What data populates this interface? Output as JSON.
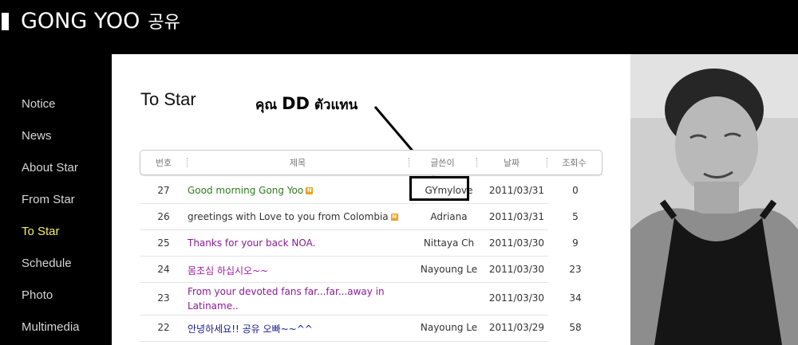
{
  "header": {
    "logo_text": "GONG YOO",
    "logo_korean": "공유"
  },
  "sidebar": {
    "items": [
      {
        "label": "Notice"
      },
      {
        "label": "News"
      },
      {
        "label": "About Star"
      },
      {
        "label": "From Star"
      },
      {
        "label": "To Star",
        "active": true
      },
      {
        "label": "Schedule"
      },
      {
        "label": "Photo"
      },
      {
        "label": "Multimedia"
      }
    ]
  },
  "main": {
    "title": "To Star",
    "annotation": {
      "prefix": "คุณ",
      "name": "DD",
      "suffix": "ตัวแทน"
    },
    "table": {
      "headers": [
        "번호",
        "제목",
        "글쓴이",
        "날짜",
        "조회수"
      ],
      "rows": [
        {
          "num": "27",
          "title": "Good morning Gong Yoo",
          "new": true,
          "author": "GYmylove",
          "date": "2011/03/31",
          "views": "0",
          "title_color": "#2e7d1e"
        },
        {
          "num": "26",
          "title": "greetings with Love to you from Colombia",
          "new": true,
          "author": "Adriana",
          "date": "2011/03/31",
          "views": "5",
          "title_color": "#333333"
        },
        {
          "num": "25",
          "title": "Thanks for your back NOA.",
          "new": false,
          "author": "Nittaya Ch",
          "date": "2011/03/30",
          "views": "9",
          "title_color": "#8b1a9a"
        },
        {
          "num": "24",
          "title": "몸조심 하십시오~~",
          "new": false,
          "author": "Nayoung Le",
          "date": "2011/03/30",
          "views": "23",
          "title_color": "#a01aa8"
        },
        {
          "num": "23",
          "title": "From your devoted fans far...far...away in Latiname..",
          "new": false,
          "author": "",
          "date": "2011/03/30",
          "views": "34",
          "title_color": "#8b1a9a"
        },
        {
          "num": "22",
          "title": "안녕하세요!! 공유 오빠~~^^",
          "new": false,
          "author": "Nayoung Le",
          "date": "2011/03/29",
          "views": "58",
          "title_color": "#1a1a8b"
        }
      ]
    }
  },
  "colors": {
    "nav_active": "#f4ee6a",
    "nav_text": "#d6d6d6",
    "new_badge": "#f0a020"
  }
}
